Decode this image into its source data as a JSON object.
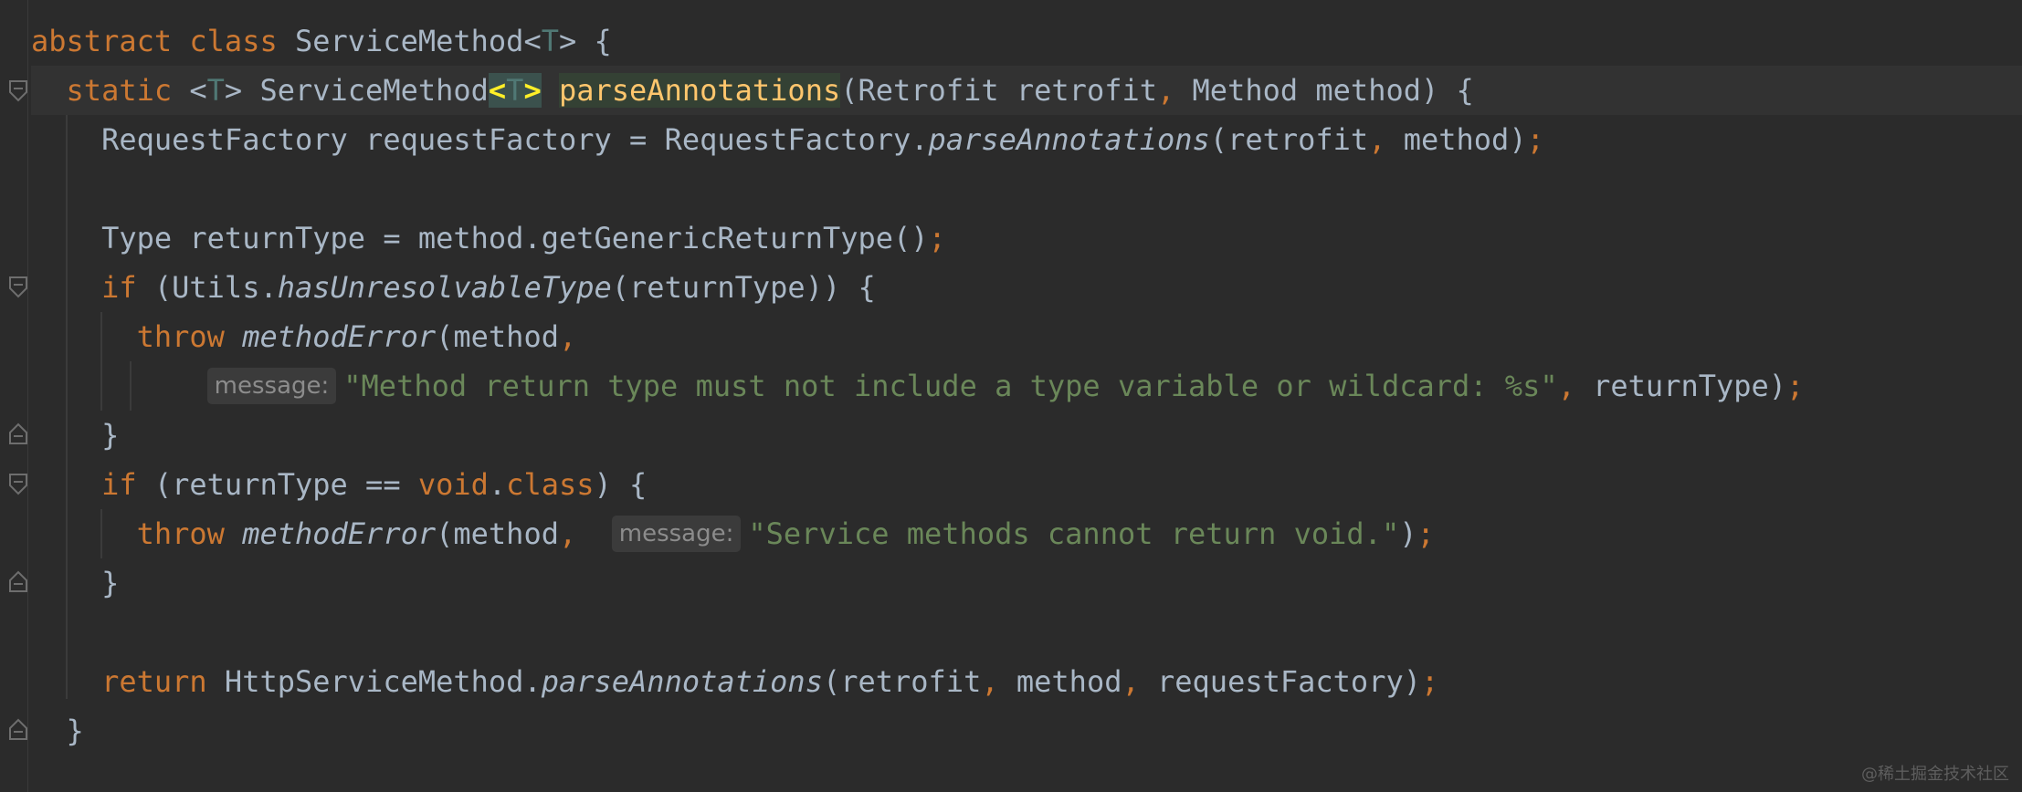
{
  "code": {
    "l1": {
      "kw_abstract": "abstract",
      "kw_class": "class",
      "class_name": "ServiceMethod",
      "lt": "<",
      "T": "T",
      "gt": ">",
      "brace": " {"
    },
    "l2": {
      "kw_static": "static",
      "lt": "<",
      "T": "T",
      "gt": ">",
      "ret_type": "ServiceMethod",
      "lt2": "<",
      "T2": "T",
      "gt2": ">",
      "method_name": "parseAnnotations",
      "params_a": "(Retrofit retrofit",
      "comma": ",",
      "params_b": " Method method) {"
    },
    "l3": {
      "prefix": "RequestFactory requestFactory = RequestFactory.",
      "call": "parseAnnotations",
      "args": "(retrofit",
      "comma": ",",
      "args2": " method)",
      "semi": ";"
    },
    "l5": {
      "prefix": "Type returnType = method.getGenericReturnType()",
      "semi": ";"
    },
    "l6": {
      "kw_if": "if",
      "open": " (Utils.",
      "call": "hasUnresolvableType",
      "rest": "(returnType)) {"
    },
    "l7": {
      "kw_throw": "throw",
      "call": "methodError",
      "args": "(method",
      "comma": ","
    },
    "l8": {
      "hint": "message:",
      "string": "\"Method return type must not include a type variable or wildcard: %s\"",
      "comma": ",",
      "rest": " returnType)",
      "semi": ";"
    },
    "l9": {
      "brace": "}"
    },
    "l10": {
      "kw_if": "if",
      "open": " (returnType == ",
      "kw_void": "void",
      "dot": ".",
      "kw_class": "class",
      "rest": ") {"
    },
    "l11": {
      "kw_throw": "throw",
      "call": "methodError",
      "args": "(method",
      "comma": ",",
      "hint": "message:",
      "string": "\"Service methods cannot return void.\"",
      "rest": ")",
      "semi": ";"
    },
    "l12": {
      "brace": "}"
    },
    "l14": {
      "kw_return": "return",
      "prefix": " HttpServiceMethod.",
      "call": "parseAnnotations",
      "args": "(retrofit",
      "comma1": ",",
      "args2": " method",
      "comma2": ",",
      "args3": " requestFactory)",
      "semi": ";"
    },
    "l15": {
      "brace": "}"
    }
  },
  "watermark": "@稀土掘金技术社区",
  "colors": {
    "background": "#2b2b2b",
    "keyword": "#cc7832",
    "string": "#6a8759",
    "function": "#ffc66d",
    "text": "#a9b7c6",
    "type_param": "#507874"
  }
}
